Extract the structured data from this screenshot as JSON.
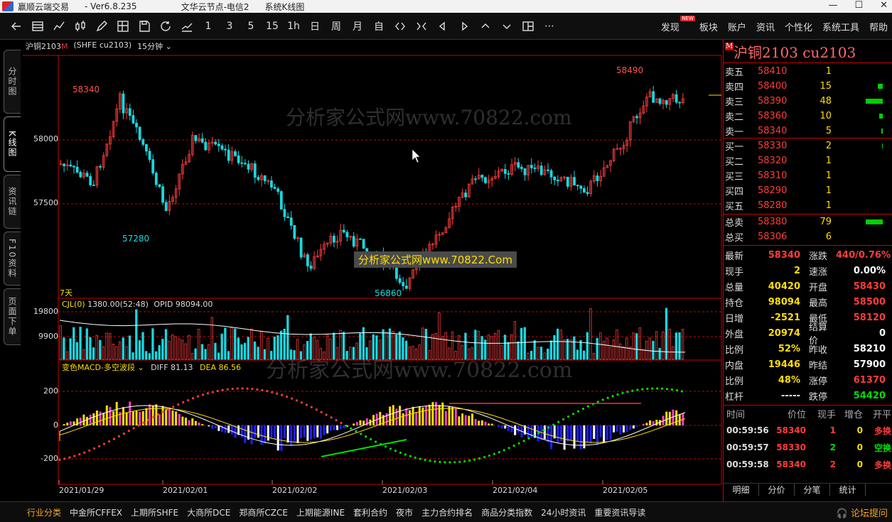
{
  "titlebar": {
    "app": "赢顺云端交易",
    "version": "- Ver6.8.235",
    "server": "文华云节点-电信2",
    "view": "系统K线图"
  },
  "toolbar": {
    "text_buttons": [
      "1",
      "3",
      "5",
      "15",
      "1h",
      "日",
      "周",
      "月",
      "自"
    ],
    "menu": [
      "发现",
      "板块",
      "账户",
      "资讯",
      "个性化",
      "系统工具",
      "帮助"
    ],
    "new_badge": "NEW"
  },
  "left_tabs": [
    {
      "label": "分时图",
      "active": false
    },
    {
      "label": "K线图",
      "active": true
    },
    {
      "label": "资讯链",
      "active": false
    },
    {
      "label": "F10资料",
      "active": false
    },
    {
      "label": "页面下单",
      "active": false
    }
  ],
  "chart_header": {
    "name": "沪铜2103",
    "mark": "M",
    "code": "(SHFE cu2103)",
    "period": "15分钟"
  },
  "watermarks": {
    "top": "分析家公式网www.70822.com",
    "middle": "分析家公式网www.70822.Com",
    "bottom": "分析家公式网www.70822.com"
  },
  "price_axis": {
    "ticks": [
      "58000",
      "57500"
    ]
  },
  "price_labels": {
    "high1": "58340",
    "low1": "57280",
    "low2": "56860",
    "high2": "58490",
    "days": "7天"
  },
  "cjl": {
    "label": "CJL(0)",
    "value": "1380.00(52:48)",
    "opid": "OPID 98094.00",
    "ticks": [
      "19800",
      "9900"
    ]
  },
  "macd": {
    "label": "变色MACD-多空波段",
    "diff": "DIFF 81.13",
    "dea": "DEA 86.56",
    "ticks": [
      "200",
      "0",
      "-200"
    ]
  },
  "dates": [
    "2021/01/29",
    "2021/02/01",
    "2021/02/02",
    "2021/02/03",
    "2021/02/04",
    "2021/02/05"
  ],
  "quote": {
    "title": "沪铜2103  cu2103",
    "mark": "M",
    "asks": [
      {
        "label": "卖五",
        "price": "58410",
        "vol": "1",
        "bar": 0.0
      },
      {
        "label": "卖四",
        "price": "58400",
        "vol": "15",
        "bar": 0.3
      },
      {
        "label": "卖三",
        "price": "58390",
        "vol": "48",
        "bar": 1.0
      },
      {
        "label": "卖二",
        "price": "58360",
        "vol": "10",
        "bar": 0.2
      },
      {
        "label": "卖一",
        "price": "58340",
        "vol": "5",
        "bar": 0.1
      }
    ],
    "bids": [
      {
        "label": "买一",
        "price": "58330",
        "vol": "2",
        "bar": 0.05
      },
      {
        "label": "买二",
        "price": "58320",
        "vol": "1",
        "bar": 0.0
      },
      {
        "label": "买三",
        "price": "58310",
        "vol": "1",
        "bar": 0.0
      },
      {
        "label": "买四",
        "price": "58290",
        "vol": "1",
        "bar": 0.0
      },
      {
        "label": "买五",
        "price": "58280",
        "vol": "1",
        "bar": 0.0
      }
    ],
    "totals": [
      {
        "label": "总卖",
        "price": "58380",
        "vol": "79",
        "bar": 1.0
      },
      {
        "label": "总买",
        "price": "58306",
        "vol": "6",
        "bar": 0.0
      }
    ],
    "stats": [
      {
        "l1": "最新",
        "v1": "58340",
        "c1": "#ff3c3c",
        "l2": "涨跌",
        "v2": "440/0.76%",
        "c2": "#ff3c3c"
      },
      {
        "l1": "现手",
        "v1": "2",
        "c1": "#ffde00",
        "l2": "速涨",
        "v2": "0.00%",
        "c2": "#ffffff"
      },
      {
        "l1": "总量",
        "v1": "40420",
        "c1": "#ffde00",
        "l2": "开盘",
        "v2": "58430",
        "c2": "#ff3c3c"
      },
      {
        "l1": "持仓",
        "v1": "98094",
        "c1": "#ffde00",
        "l2": "最高",
        "v2": "58500",
        "c2": "#ff3c3c"
      },
      {
        "l1": "日增",
        "v1": "-2521",
        "c1": "#ffde00",
        "l2": "最低",
        "v2": "58120",
        "c2": "#ff3c3c"
      },
      {
        "l1": "外盘",
        "v1": "20974",
        "c1": "#ffde00",
        "l2": "结算价",
        "v2": "0",
        "c2": "#ffffff"
      },
      {
        "l1": "比例",
        "v1": "52%",
        "c1": "#ffde00",
        "l2": "昨收",
        "v2": "58210",
        "c2": "#ffffff"
      },
      {
        "l1": "内盘",
        "v1": "19446",
        "c1": "#ffde00",
        "l2": "昨结",
        "v2": "57900",
        "c2": "#ffffff"
      },
      {
        "l1": "比例",
        "v1": "48%",
        "c1": "#ffde00",
        "l2": "涨停",
        "v2": "61370",
        "c2": "#ff3c3c"
      },
      {
        "l1": "杠杆",
        "v1": "-----",
        "c1": "#ffffff",
        "l2": "跌停",
        "v2": "54420",
        "c2": "#00e000"
      }
    ],
    "tick_header": [
      "时间",
      "价位",
      "现手",
      "增仓",
      "开平"
    ],
    "ticks": [
      {
        "time": "00:59:56",
        "price": "58340",
        "hand": "1",
        "add": "0",
        "type": "多换",
        "pc": "#ff3c3c",
        "hc": "#ff3c3c",
        "tc": "#ff3c3c"
      },
      {
        "time": "00:59:57",
        "price": "58330",
        "hand": "2",
        "add": "0",
        "type": "空换",
        "pc": "#ff3c3c",
        "hc": "#00e000",
        "tc": "#00e000"
      },
      {
        "time": "00:59:58",
        "price": "58340",
        "hand": "2",
        "add": "0",
        "type": "多换",
        "pc": "#ff3c3c",
        "hc": "#ff3c3c",
        "tc": "#ff3c3c"
      }
    ],
    "tabs": [
      "明细",
      "分价",
      "分笔",
      "统计"
    ]
  },
  "bottom": {
    "items": [
      "行业分类",
      "中金所CFFEX",
      "上期所SHFE",
      "大商所DCE",
      "郑商所CZCE",
      "上期能源INE",
      "套利合约",
      "夜市",
      "主力合约排名",
      "商品分类指数",
      "24小时资讯",
      "重要资讯导读"
    ],
    "forum": "论坛提问"
  },
  "colors": {
    "up": "#ff3c3c",
    "down": "#18d8e0",
    "accent": "#ffde00",
    "border": "#cc0000"
  }
}
